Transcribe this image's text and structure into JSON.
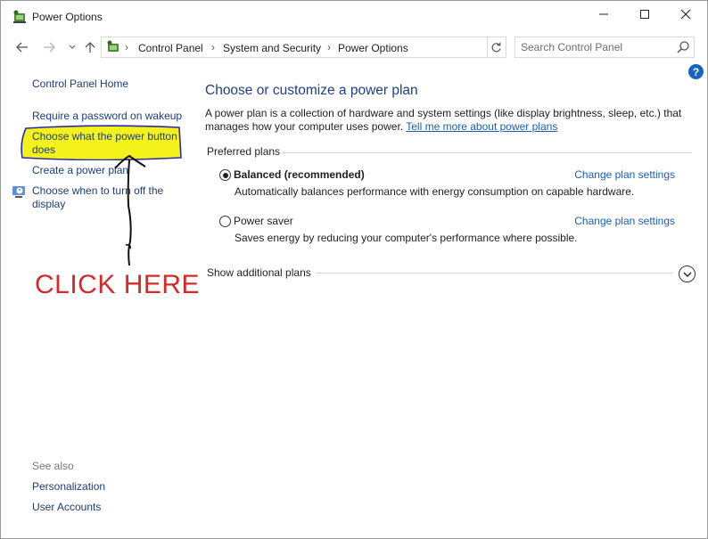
{
  "window": {
    "title": "Power Options",
    "icon": "power-options-icon"
  },
  "breadcrumb": [
    "Control Panel",
    "System and Security",
    "Power Options"
  ],
  "search": {
    "placeholder": "Search Control Panel"
  },
  "help_label": "?",
  "left_pane": {
    "home": "Control Panel Home",
    "links": [
      "Require a password on wakeup",
      "Choose what the power button does",
      "Create a power plan",
      "Choose when to turn off the display"
    ],
    "see_also_heading": "See also",
    "see_also": [
      "Personalization",
      "User Accounts"
    ]
  },
  "annotation": {
    "callout": "CLICK HERE",
    "highlight_color": "#f4f21a",
    "callout_color": "#d42a2a"
  },
  "main": {
    "title": "Choose or customize a power plan",
    "description": "A power plan is a collection of hardware and system settings (like display brightness, sleep, etc.) that manages how your computer uses power. ",
    "learn_more": "Tell me more about power plans",
    "preferred_heading": "Preferred plans",
    "plans": [
      {
        "name": "Balanced (recommended)",
        "selected": true,
        "description": "Automatically balances performance with energy consumption on capable hardware.",
        "action": "Change plan settings"
      },
      {
        "name": "Power saver",
        "selected": false,
        "description": "Saves energy by reducing your computer's performance where possible.",
        "action": "Change plan settings"
      }
    ],
    "show_additional": "Show additional plans"
  }
}
